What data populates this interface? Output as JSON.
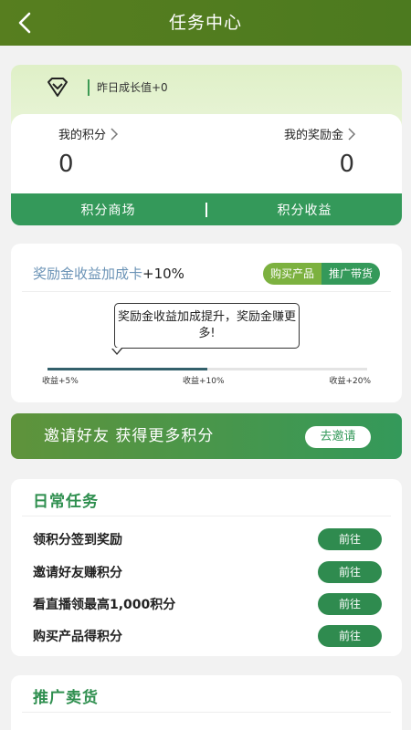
{
  "header": {
    "title": "任务中心"
  },
  "growth": {
    "text": "昨日成长值+0"
  },
  "points": {
    "my_points_label": "我的积分",
    "my_points_value": "0",
    "my_bonus_label": "我的奖励金",
    "my_bonus_value": "0",
    "shop_label": "积分商场",
    "earnings_label": "积分收益"
  },
  "bonus_card": {
    "title_prefix": "奖励金收益加成卡",
    "title_value": "+10%",
    "tab_buy": "购买产品",
    "tab_promote": "推广带货",
    "tooltip": "奖励金收益加成提升，奖励金赚更多!",
    "progress": 0.5,
    "ticks": [
      "收益+5%",
      "收益+10%",
      "收益+20%"
    ]
  },
  "invite": {
    "text": "邀请好友 获得更多积分",
    "button": "去邀请"
  },
  "daily": {
    "title": "日常任务",
    "tasks": [
      {
        "name": "领积分签到奖励",
        "action": "前往"
      },
      {
        "name": "邀请好友赚积分",
        "action": "前往"
      },
      {
        "name": "看直播领最高1,000积分",
        "action": "前往"
      },
      {
        "name": "购买产品得积分",
        "action": "前往"
      }
    ]
  },
  "promo": {
    "title": "推广卖货"
  },
  "colors": {
    "primary": "#34995a",
    "header": "#577e1f",
    "light_green": "#7cb13f"
  }
}
